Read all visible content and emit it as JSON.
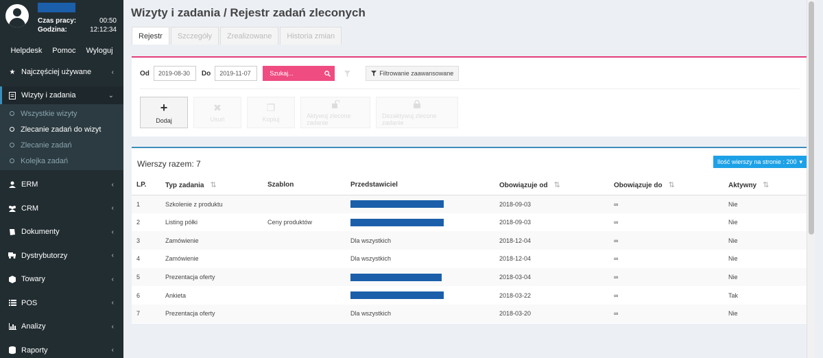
{
  "user": {
    "work_time_label": "Czas pracy:",
    "work_time_value": "00:50",
    "clock_label": "Godzina:",
    "clock_value": "12:12:34"
  },
  "top_links": [
    "Helpdesk",
    "Pomoc",
    "Wyloguj"
  ],
  "sidebar": {
    "items_before": [
      {
        "label": "Najczęściej używane",
        "icon": "star-icon"
      }
    ],
    "active_item": {
      "label": "Wizyty i zadania",
      "icon": "document-icon"
    },
    "submenu": [
      {
        "label": "Wszystkie wizyty",
        "active": false
      },
      {
        "label": "Zlecanie zadań do wizyt",
        "active": true
      },
      {
        "label": "Zlecanie zadań",
        "active": false
      },
      {
        "label": "Kolejka zadań",
        "active": false
      }
    ],
    "items_after": [
      {
        "label": "ERM",
        "icon": "user-icon"
      },
      {
        "label": "CRM",
        "icon": "users-icon"
      },
      {
        "label": "Dokumenty",
        "icon": "book-icon"
      },
      {
        "label": "Dystrybutorzy",
        "icon": "truck-icon"
      },
      {
        "label": "Towary",
        "icon": "cube-icon"
      },
      {
        "label": "POS",
        "icon": "list-icon"
      },
      {
        "label": "Analizy",
        "icon": "bar-chart-icon"
      },
      {
        "label": "Raporty",
        "icon": "database-icon"
      }
    ]
  },
  "page": {
    "title": "Wizyty i zadania / Rejestr zadań zleconych",
    "tabs": [
      {
        "label": "Rejestr",
        "active": true
      },
      {
        "label": "Szczegóły",
        "active": false
      },
      {
        "label": "Zrealizowane",
        "active": false
      },
      {
        "label": "Historia zmian",
        "active": false
      }
    ]
  },
  "filters": {
    "from_label": "Od",
    "from_value": "2019-08-30",
    "to_label": "Do",
    "to_value": "2019-11-07",
    "search_placeholder": "Szukaj...",
    "advanced_label": "Filtrowanie zaawansowane"
  },
  "actions": {
    "add": "Dodaj",
    "delete": "Usuń",
    "copy": "Kopiuj",
    "activate": "Aktywuj zlecone zadanie",
    "deactivate": "Dezaktywuj zlecone zadanie"
  },
  "table": {
    "rows_total": "Wierszy razem: 7",
    "rows_per_page": "Ilość wierszy na stronie : 200",
    "headers": [
      "LP.",
      "Typ zadania",
      "Szablon",
      "Przedstawiciel",
      "Obowiązuje od",
      "Obowiązuje do",
      "Aktywny"
    ],
    "rows": [
      {
        "lp": "1",
        "type": "Szkolenie z produktu",
        "template": "",
        "rep": "",
        "rep_redacted": true,
        "from": "2018-09-03",
        "to": "∞",
        "active": "Nie"
      },
      {
        "lp": "2",
        "type": "Listing półki",
        "template": "Ceny produktów",
        "rep": "",
        "rep_redacted": true,
        "from": "2018-09-03",
        "to": "∞",
        "active": "Nie"
      },
      {
        "lp": "3",
        "type": "Zamówienie",
        "template": "",
        "rep": "Dla wszystkich",
        "rep_redacted": false,
        "from": "2018-12-04",
        "to": "∞",
        "active": "Nie"
      },
      {
        "lp": "4",
        "type": "Zamówienie",
        "template": "",
        "rep": "Dla wszystkich",
        "rep_redacted": false,
        "from": "2018-12-04",
        "to": "∞",
        "active": "Nie"
      },
      {
        "lp": "5",
        "type": "Prezentacja oferty",
        "template": "",
        "rep": "",
        "rep_redacted": true,
        "from": "2018-03-04",
        "to": "∞",
        "active": "Nie"
      },
      {
        "lp": "6",
        "type": "Ankieta",
        "template": "",
        "rep": "",
        "rep_redacted": true,
        "from": "2018-03-22",
        "to": "∞",
        "active": "Tak"
      },
      {
        "lp": "7",
        "type": "Prezentacja oferty",
        "template": "",
        "rep": "Dla wszystkich",
        "rep_redacted": false,
        "from": "2018-03-20",
        "to": "∞",
        "active": "Nie"
      }
    ]
  },
  "colors": {
    "sidebar_bg": "#222d32",
    "search_pink": "#ef4c82",
    "accent_blue": "#1da1e6",
    "redaction": "#1b5faa"
  }
}
